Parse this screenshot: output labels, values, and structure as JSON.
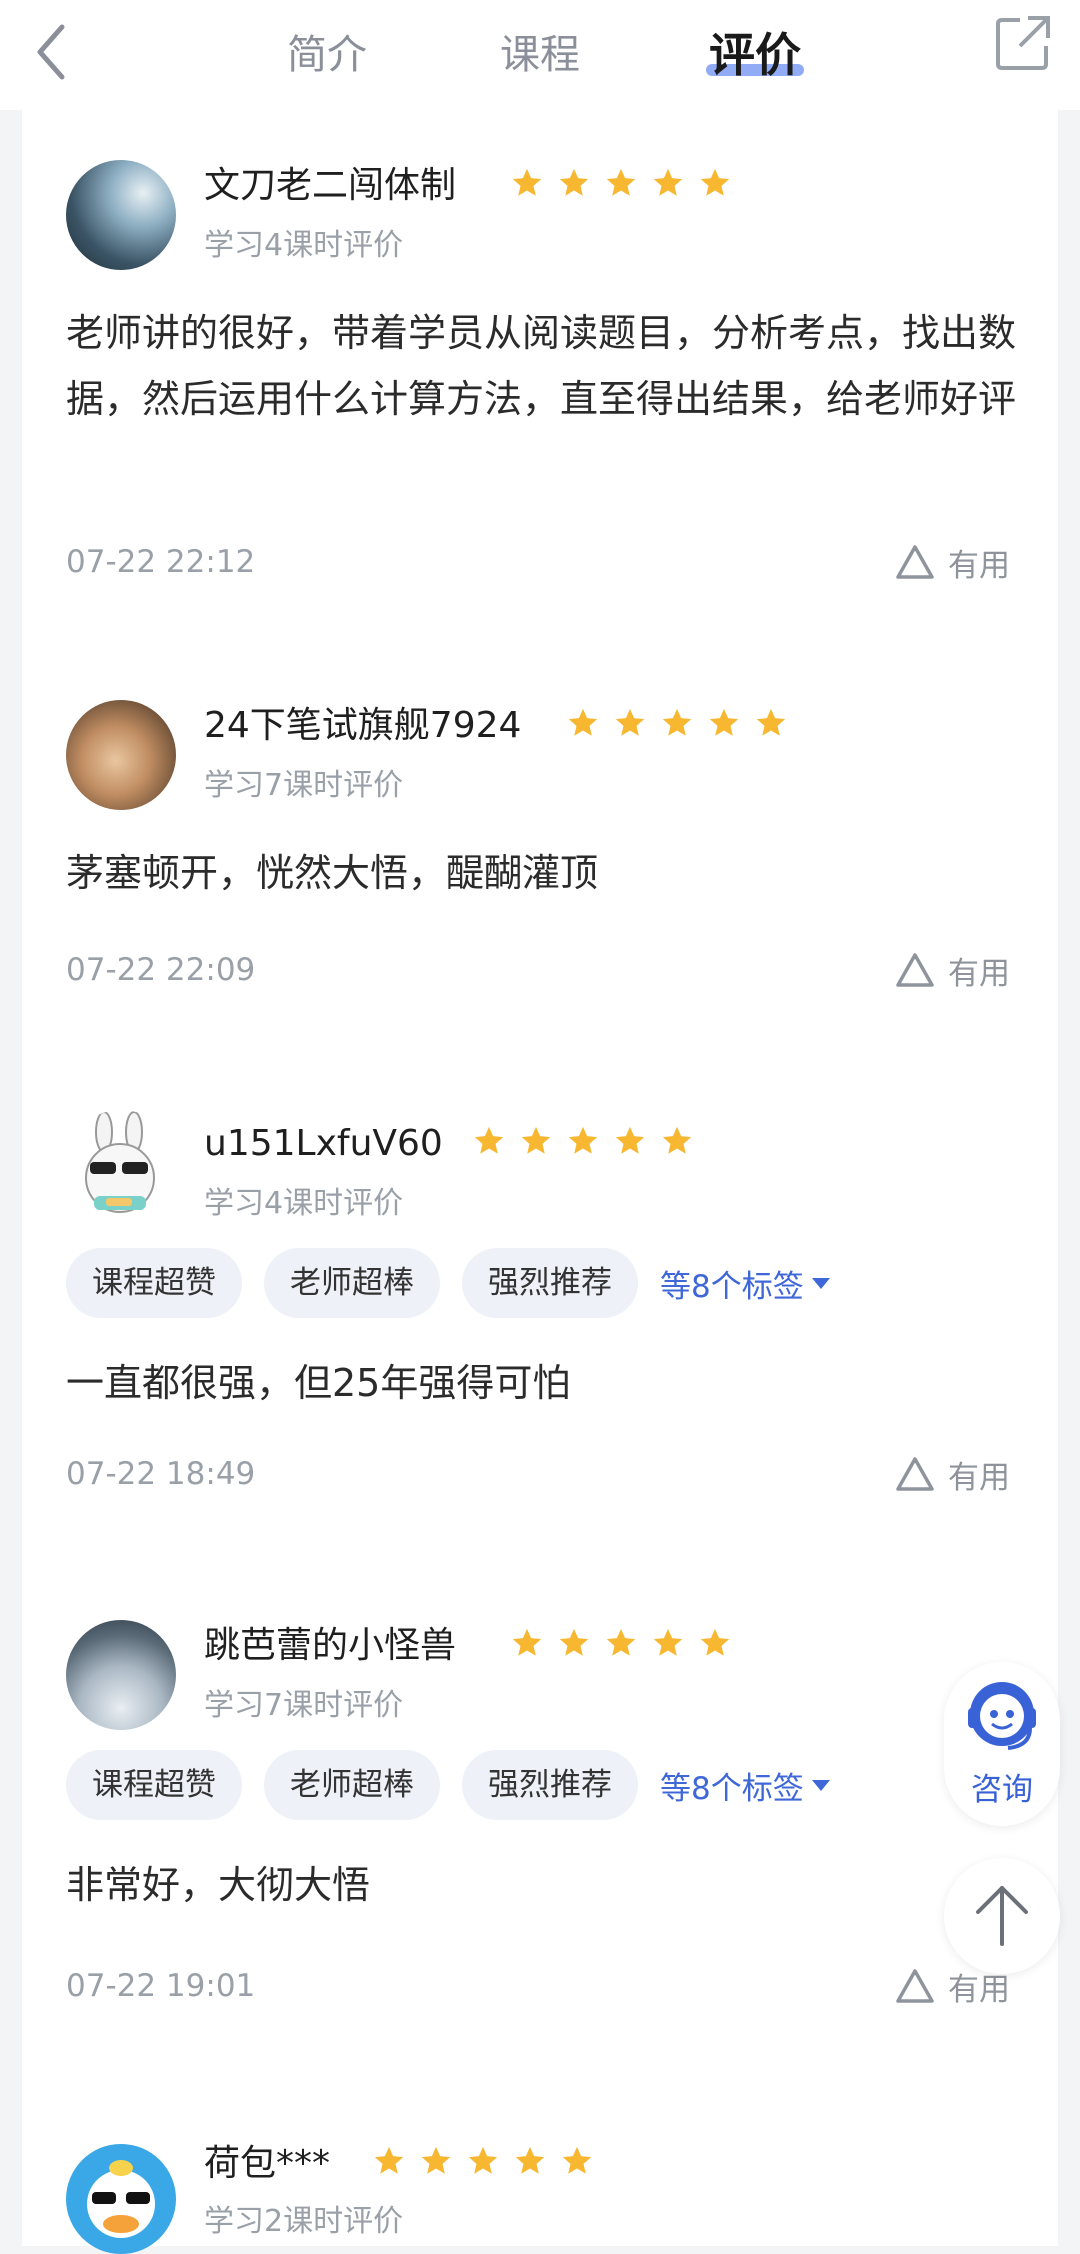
{
  "header": {
    "tabs": [
      {
        "label": "简介",
        "active": false
      },
      {
        "label": "课程",
        "active": false
      },
      {
        "label": "评价",
        "active": true
      }
    ],
    "back_icon": "chevron-left-icon",
    "share_icon": "external-share-icon"
  },
  "reviews": [
    {
      "username": "文刀老二闯体制",
      "rating": 5,
      "subtitle": "学习4课时评价",
      "content": "老师讲的很好，带着学员从阅读题目，分析考点，找出数据，然后运用什么计算方法，直至得出结果，给老师好评",
      "time": "07-22 22:12",
      "useful_label": "有用",
      "tags": [],
      "more_tags": ""
    },
    {
      "username": "24下笔试旗舰7924",
      "rating": 5,
      "subtitle": "学习7课时评价",
      "content": "茅塞顿开，恍然大悟，醍醐灌顶",
      "time": "07-22 22:09",
      "useful_label": "有用",
      "tags": [],
      "more_tags": ""
    },
    {
      "username": "u151LxfuV60",
      "rating": 5,
      "subtitle": "学习4课时评价",
      "content": "一直都很强，但25年强得可怕",
      "time": "07-22 18:49",
      "useful_label": "有用",
      "tags": [
        "课程超赞",
        "老师超棒",
        "强烈推荐"
      ],
      "more_tags": "等8个标签"
    },
    {
      "username": "跳芭蕾的小怪兽",
      "rating": 5,
      "subtitle": "学习7课时评价",
      "content": "非常好，大彻大悟",
      "time": "07-22 19:01",
      "useful_label": "有用",
      "tags": [
        "课程超赞",
        "老师超棒",
        "强烈推荐"
      ],
      "more_tags": "等8个标签"
    },
    {
      "username": "荷包***",
      "rating": 5,
      "subtitle": "学习2课时评价",
      "content": "",
      "time": "",
      "useful_label": "",
      "tags": [],
      "more_tags": ""
    }
  ],
  "floating": {
    "consult_label": "咨询",
    "consult_icon": "customer-service-icon",
    "top_icon": "arrow-up-icon"
  },
  "colors": {
    "star": "#f7b731",
    "accent": "#3f67d8",
    "tab_underline": "#7e9cf3"
  }
}
